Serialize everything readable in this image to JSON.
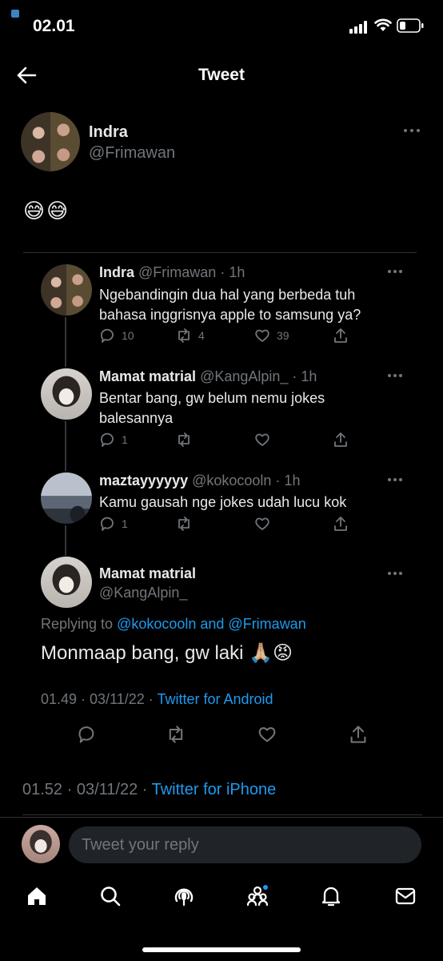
{
  "status": {
    "time": "02.01"
  },
  "header": {
    "title": "Tweet"
  },
  "main_tweet": {
    "name": "Indra",
    "handle": "@Frimawan",
    "content": "😅😅",
    "posted": "01.52 · 03/11/22 ·",
    "via": "Twitter for iPhone"
  },
  "quoted": {
    "tweets": [
      {
        "name": "Indra",
        "handle": "@Frimawan · 1h",
        "text": "Ngebandingin dua hal yang berbeda tuh bahasa inggrisnya apple to samsung ya?",
        "replies": "10",
        "retweets": "4",
        "likes": "39"
      },
      {
        "name": "Mamat matrial",
        "handle": "@KangAlpin_ · 1h",
        "text": "Bentar bang, gw belum nemu jokes balesannya",
        "replies": "1",
        "retweets": "",
        "likes": ""
      },
      {
        "name": "maztayyyyyy",
        "handle": "@kokocooln · 1h",
        "text": "Kamu gausah nge jokes udah lucu kok",
        "replies": "1",
        "retweets": "",
        "likes": ""
      }
    ],
    "final": {
      "name": "Mamat matrial",
      "handle": "@KangAlpin_",
      "replying_prefix": "Replying to ",
      "replying_to": "@kokocooln and @Frimawan",
      "text": "Monmaap bang, gw laki 🙏🏼😡",
      "posted": "01.49 · 03/11/22 ·",
      "via": "Twitter for Android"
    }
  },
  "reply_box": {
    "placeholder": "Tweet your reply"
  },
  "colors": {
    "accent": "#1d9bf0",
    "muted": "#71767b",
    "background": "#000000"
  }
}
